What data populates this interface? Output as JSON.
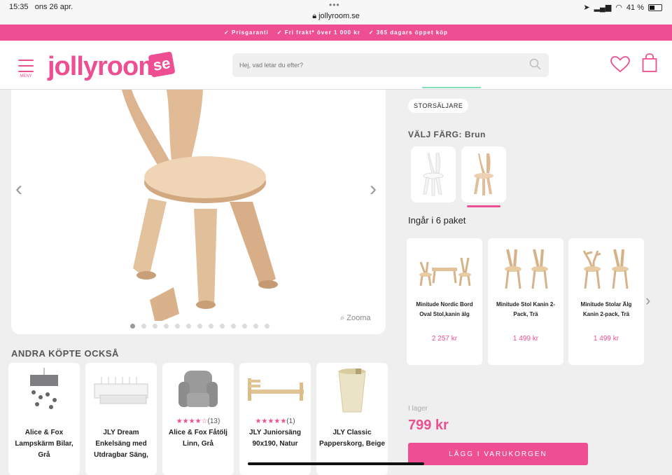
{
  "status": {
    "time": "15:35",
    "date": "ons 26 apr.",
    "url": "jollyroom.se",
    "battery": "41 %"
  },
  "promo": [
    "✓ Prisgaranti",
    "✓ Fri frakt* över 1 000 kr",
    "✓ 365 dagars öppet köp"
  ],
  "header": {
    "menu_label": "MENY",
    "logo": "jollyroom",
    "logo_tld": "se",
    "search_placeholder": "Hej, vad letar du efter?"
  },
  "gallery": {
    "zoom_label": "Zooma",
    "dot_count": 13,
    "active_dot": 0
  },
  "recommendations": {
    "title": "ANDRA KÖPTE OCKSÅ",
    "items": [
      {
        "name": "Alice & Fox Lampskärm Bilar, Grå",
        "stars": "",
        "reviews": ""
      },
      {
        "name": "JLY Dream Enkelsäng med Utdragbar Säng,",
        "stars": "",
        "reviews": ""
      },
      {
        "name": "Alice & Fox Fåtölj Linn, Grå",
        "stars": "★★★★☆",
        "reviews": "(13)"
      },
      {
        "name": "JLY Juniorsäng 90x190, Natur",
        "stars": "★★★★★",
        "reviews": "(1)"
      },
      {
        "name": "JLY Classic Papperskorg, Beige",
        "stars": "",
        "reviews": ""
      }
    ]
  },
  "product": {
    "badge": "STORSÄLJARE",
    "color_label": "VÄLJ FÄRG: Brun",
    "packages_title": "Ingår i 6 paket",
    "packages": [
      {
        "name": "Minitude Nordic Bord Oval Stol,kanin älg",
        "price": "2 257 kr"
      },
      {
        "name": "Minitude Stol Kanin 2-Pack, Trä",
        "price": "1 499 kr"
      },
      {
        "name": "Minitude Stolar Älg Kanin 2-pack, Trä",
        "price": "1 499 kr"
      }
    ],
    "stock": "I lager",
    "price": "799 kr",
    "buy_label": "LÄGG I VARUKORGEN"
  },
  "colors": {
    "accent": "#ee4f93",
    "wood": "#e6c9a5"
  }
}
